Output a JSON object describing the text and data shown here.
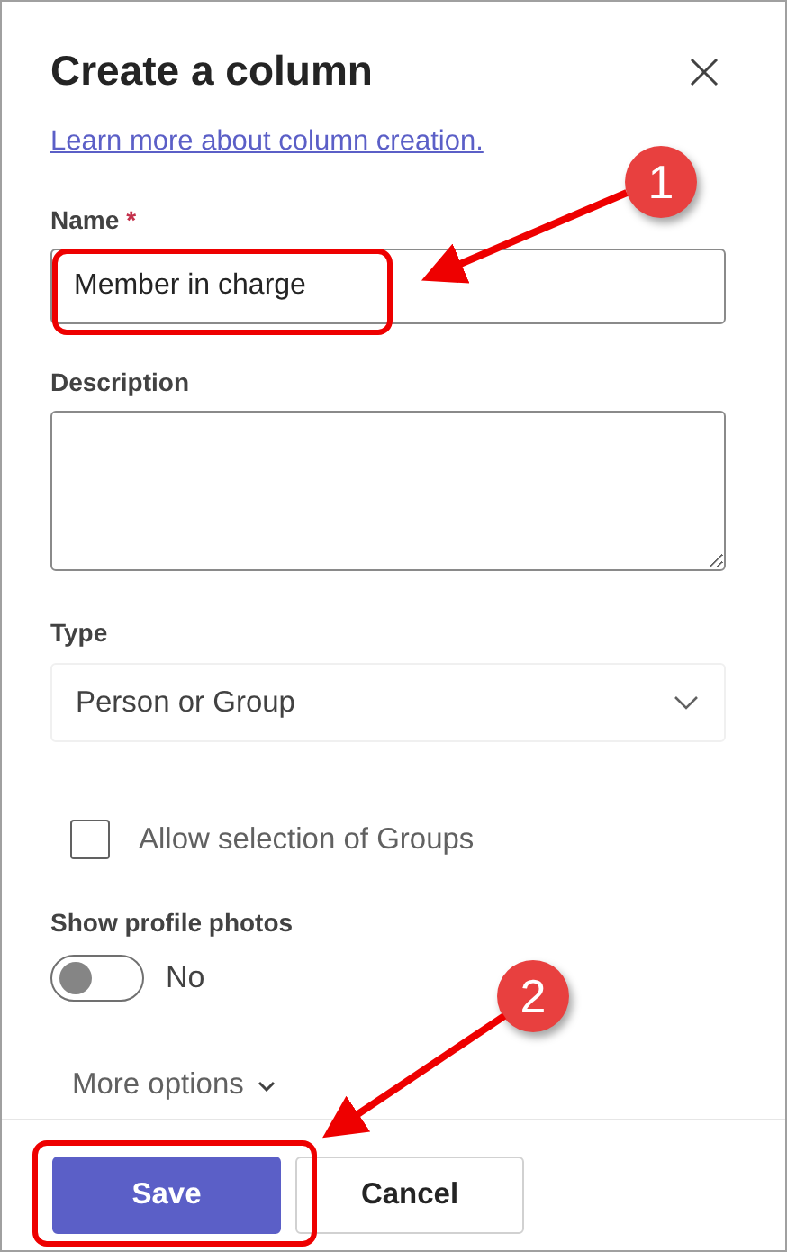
{
  "panel": {
    "title": "Create a column",
    "link": "Learn more about column creation."
  },
  "fields": [
    {
      "kind": "input",
      "label": "Name",
      "required_mark": "*",
      "value": "Member in charge"
    },
    {
      "kind": "textarea",
      "label": "Description"
    },
    {
      "kind": "select",
      "label": "Type",
      "value": "Person or Group"
    }
  ],
  "checkbox": {
    "label": "Allow selection of Groups",
    "checked": false
  },
  "toggle": {
    "label": "Show profile photos",
    "on": false,
    "state_text": "No"
  },
  "more_options": "More options",
  "buttons": [
    {
      "label": "Save",
      "kind": "primary"
    },
    {
      "label": "Cancel",
      "kind": "secondary"
    }
  ],
  "callouts": [
    {
      "label": "1"
    },
    {
      "label": "2"
    }
  ]
}
